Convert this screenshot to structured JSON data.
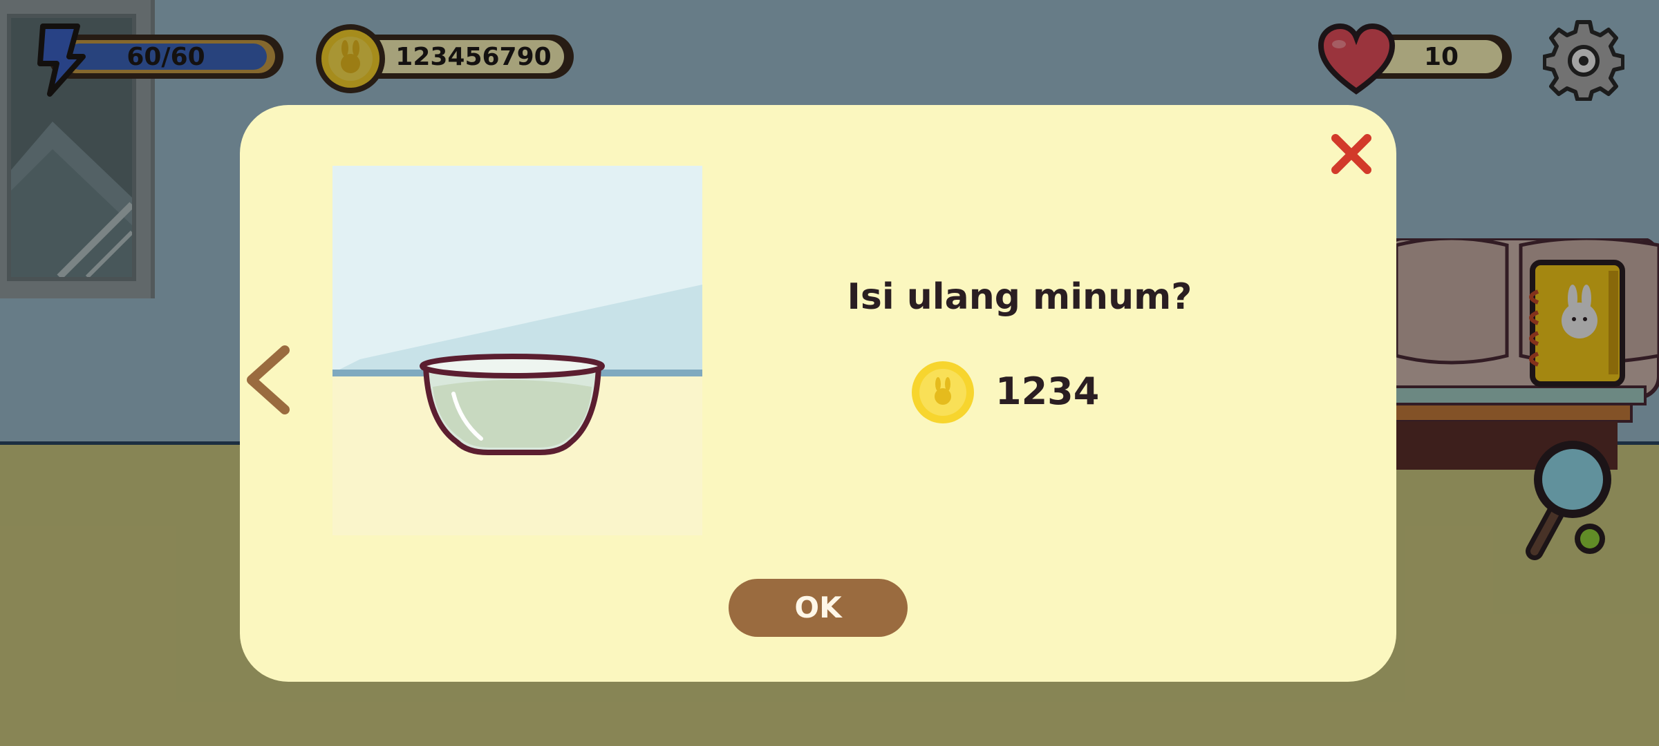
{
  "hud": {
    "energy": {
      "value_text": "60/60",
      "current": 60,
      "max": 60,
      "icon": "lightning-icon"
    },
    "coins": {
      "value_text": "123456790",
      "icon": "coin-icon"
    },
    "lives": {
      "value_text": "10",
      "icon": "heart-icon"
    },
    "settings": {
      "icon": "gear-icon"
    }
  },
  "side_buttons": {
    "journal": {
      "icon": "notebook-icon"
    },
    "search": {
      "icon": "magnifier-icon"
    }
  },
  "dialog": {
    "question": "Isi ulang minum?",
    "price": "1234",
    "price_icon": "coin-icon",
    "ok_label": "OK",
    "close_icon": "close-icon",
    "prev_icon": "chevron-left-icon",
    "preview_item": "water-bowl"
  },
  "colors": {
    "wall": "#98b7c7",
    "floor": "#c8c47e",
    "dialog_bg": "#fbf7bf",
    "ok_button": "#9a6b3f",
    "close": "#d23a2a",
    "coin": "#f5cf2a"
  }
}
